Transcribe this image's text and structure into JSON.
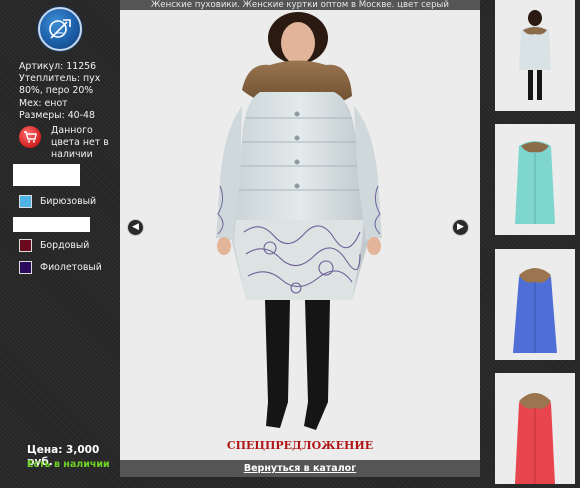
{
  "viewer": {
    "title": "Женские пуховики. Женские куртки оптом в Москве. цвет серый",
    "special_label": "СПЕЦПРЕДЛОЖЕНИЕ",
    "back_link": "Вернуться в каталог",
    "prev_icon": "chevron-left-icon",
    "next_icon": "chevron-right-icon"
  },
  "product": {
    "article": "Артикул: 11256",
    "filling": "Утеплитель: пух 80%, перо 20%",
    "fur": "Мех: енот",
    "sizes": "Размеры: 40-48",
    "stock_warning": "Данного цвета нет в наличии",
    "price": "Цена: 3,000 руб.",
    "availability": "Есть в наличии"
  },
  "colors": [
    {
      "name": "Бирюзовый",
      "hex": "#4fb3e8"
    },
    {
      "name": "Бордовый",
      "hex": "#6b0a1e"
    },
    {
      "name": "Фиолетовый",
      "hex": "#2a0a5c"
    }
  ],
  "thumbnails": [
    {
      "color": "серый",
      "coat": "#d9e2e4"
    },
    {
      "color": "бирюзовый",
      "coat": "#7fd6cf"
    },
    {
      "color": "синий",
      "coat": "#4f6fd6"
    },
    {
      "color": "красный",
      "coat": "#e8464f"
    }
  ]
}
